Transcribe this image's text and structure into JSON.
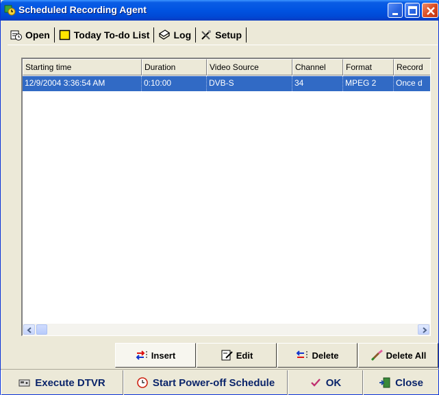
{
  "window": {
    "title": "Scheduled Recording Agent",
    "colors": {
      "titlebar": "#0053e1",
      "selection": "#316ac5",
      "face": "#ece9d8"
    }
  },
  "tabs": [
    {
      "label": "Open",
      "icon": "schedule-icon"
    },
    {
      "label": "Today To-do List",
      "icon": "note-icon"
    },
    {
      "label": "Log",
      "icon": "log-icon"
    },
    {
      "label": "Setup",
      "icon": "tools-icon"
    }
  ],
  "table": {
    "columns": [
      "Starting time",
      "Duration",
      "Video Source",
      "Channel",
      "Format",
      "Record"
    ],
    "rows": [
      [
        "12/9/2004 3:36:54 AM",
        "0:10:00",
        "DVB-S",
        "34",
        "MPEG 2",
        "Once d"
      ]
    ]
  },
  "actions": {
    "insert": "Insert",
    "edit": "Edit",
    "delete": "Delete",
    "delete_all": "Delete All"
  },
  "bottom": {
    "execute": "Execute DTVR",
    "poweroff": "Start Power-off Schedule",
    "ok": "OK",
    "close": "Close"
  }
}
